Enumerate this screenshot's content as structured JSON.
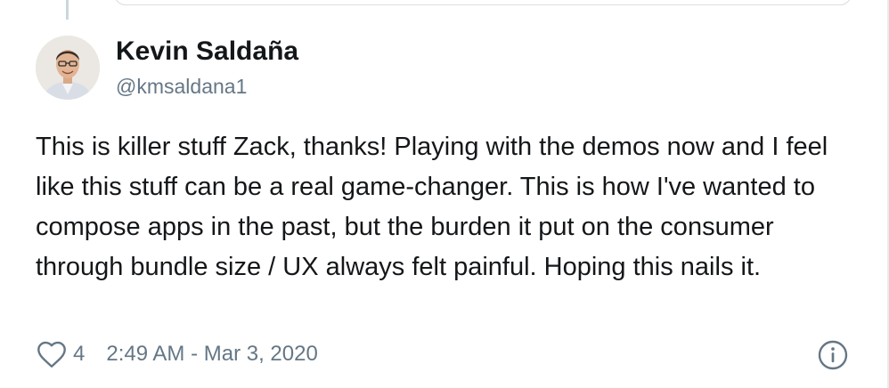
{
  "colors": {
    "text_primary": "#14171a",
    "text_secondary": "#657786",
    "border": "#ccd6dd"
  },
  "tweet": {
    "author": {
      "display_name": "Kevin Saldaña",
      "handle": "@kmsaldana1",
      "avatar_icon": "user-avatar"
    },
    "text": "This is killer stuff Zack, thanks! Playing with the demos now and I feel like this stuff can be a real game-changer. This is how I've wanted to compose apps in the past, but the burden it put on the consumer through bundle size / UX always felt painful. Hoping this nails it.",
    "likes": "4",
    "timestamp": "2:49 AM - Mar 3, 2020",
    "icons": {
      "like": "heart-icon",
      "info": "info-icon"
    }
  }
}
